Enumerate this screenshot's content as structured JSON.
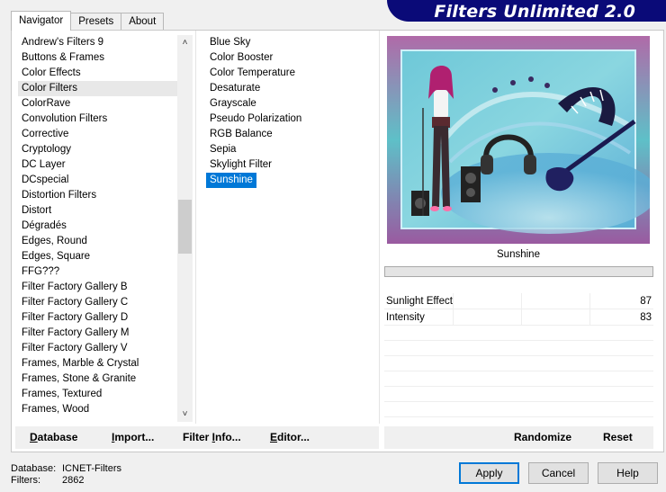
{
  "header": {
    "title": "Filters Unlimited 2.0"
  },
  "tabs": [
    {
      "label": "Navigator",
      "active": true
    },
    {
      "label": "Presets",
      "active": false
    },
    {
      "label": "About",
      "active": false
    }
  ],
  "categories": {
    "selected_index": 3,
    "items": [
      "Andrew's Filters 9",
      "Buttons & Frames",
      "Color Effects",
      "Color Filters",
      "ColorRave",
      "Convolution Filters",
      "Corrective",
      "Cryptology",
      "DC Layer",
      "DCspecial",
      "Distortion Filters",
      "Distort",
      "Dégradés",
      "Edges, Round",
      "Edges, Square",
      "FFG???",
      "Filter Factory Gallery B",
      "Filter Factory Gallery C",
      "Filter Factory Gallery D",
      "Filter Factory Gallery M",
      "Filter Factory Gallery V",
      "Frames, Marble & Crystal",
      "Frames, Stone & Granite",
      "Frames, Textured",
      "Frames, Wood"
    ],
    "scroll_up_icon": "chevron-up-icon",
    "scroll_down_icon": "chevron-down-icon"
  },
  "filters": {
    "selected_index": 9,
    "items": [
      "Blue Sky",
      "Color Booster",
      "Color Temperature",
      "Desaturate",
      "Grayscale",
      "Pseudo Polarization",
      "RGB Balance",
      "Sepia",
      "Skylight Filter",
      "Sunshine"
    ]
  },
  "preview": {
    "filter_name": "Sunshine",
    "progress": 0
  },
  "parameters": [
    {
      "name": "Sunlight Effect",
      "value": "87"
    },
    {
      "name": "Intensity",
      "value": "83"
    }
  ],
  "toolbar": {
    "database": {
      "accel": "D",
      "rest": "atabase"
    },
    "import": {
      "accel": "I",
      "rest": "mport..."
    },
    "filter_info": {
      "pre": "Filter ",
      "accel": "I",
      "rest": "nfo..."
    },
    "editor": {
      "accel": "E",
      "rest": "ditor..."
    },
    "randomize": "Randomize",
    "reset": "Reset"
  },
  "footer": {
    "database_label": "Database:",
    "database_value": "ICNET-Filters",
    "filters_label": "Filters:",
    "filters_value": "2862"
  },
  "dialog_buttons": {
    "apply": "Apply",
    "cancel": "Cancel",
    "help": "Help"
  },
  "colors": {
    "banner": "#0a0a78",
    "selection": "#0078d7",
    "default_border": "#0078d7"
  }
}
